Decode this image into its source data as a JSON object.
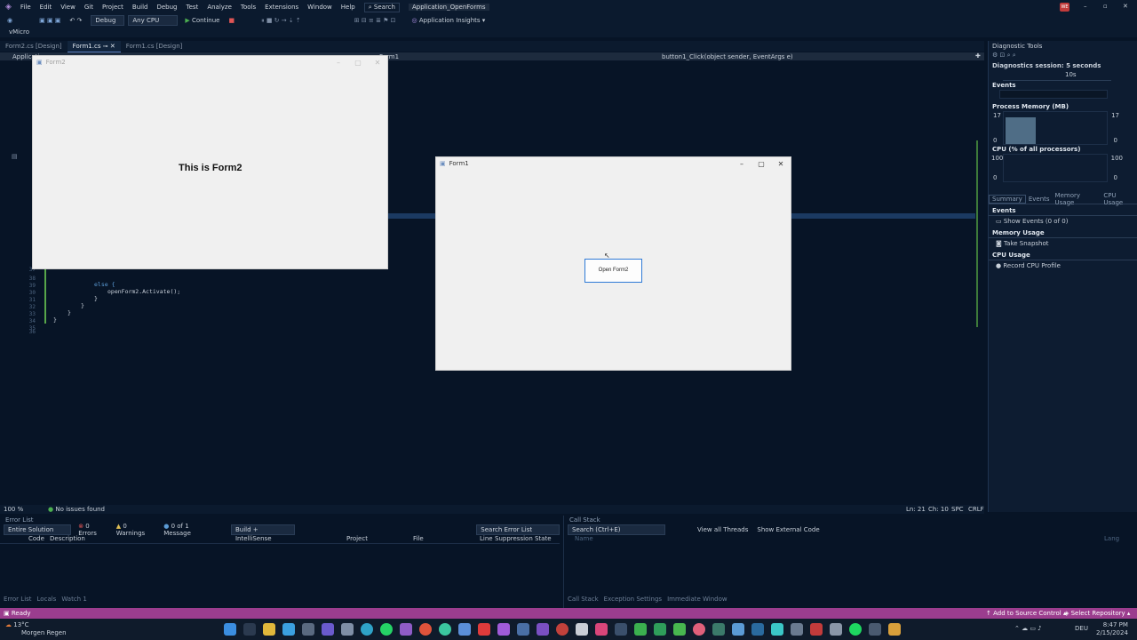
{
  "menu": [
    "File",
    "Edit",
    "View",
    "Git",
    "Project",
    "Build",
    "Debug",
    "Test",
    "Analyze",
    "Tools",
    "Extensions",
    "Window",
    "Help"
  ],
  "search_label": "Search",
  "solution_name": "Application_OpenForms",
  "user_badge": "WE",
  "toolbar": {
    "config": "Debug",
    "platform": "Any CPU",
    "continue": "Continue",
    "insights": "Application Insights"
  },
  "toolbar2_label": "vMicro",
  "tabs": [
    "Form2.cs [Design]",
    "Form1.cs",
    "Form1.cs [Design]"
  ],
  "navbar": {
    "left": "Applicati",
    "middle": "...ns.Form1",
    "right": "button1_Click(object sender, EventArgs e)"
  },
  "code": {
    "lines": [
      "37",
      "38",
      "39",
      "30",
      "31",
      "32",
      "33",
      "34",
      "35",
      "36"
    ],
    "else_kw": "else {",
    "activate": "openForm2.Activate();",
    "brace": "}"
  },
  "form2": {
    "title": "Form2",
    "label": "This is Form2"
  },
  "form1": {
    "title": "Form1",
    "button": "Open Form2"
  },
  "editor_status": {
    "zoom": "100 %",
    "issues": "No issues found",
    "ln": "Ln: 21",
    "ch": "Ch: 10",
    "spc": "SPC",
    "crlf": "CRLF"
  },
  "diagnostics": {
    "title": "Diagnostic Tools",
    "session": "Diagnostics session: 5 seconds",
    "tick": "10s",
    "events": "Events",
    "memory_title": "Process Memory (MB)",
    "memory_max": "17",
    "memory_min": "0",
    "cpu_title": "CPU (% of all processors)",
    "cpu_max": "100",
    "cpu_min": "0",
    "subtabs": [
      "Summary",
      "Events",
      "Memory Usage",
      "CPU Usage"
    ],
    "events_section": "Events",
    "show_events": "Show Events (0 of 0)",
    "memory_section": "Memory Usage",
    "snapshot": "Take Snapshot",
    "cpu_section": "CPU Usage",
    "record": "Record CPU Profile"
  },
  "error_list": {
    "title": "Error List",
    "scope": "Entire Solution",
    "errors": "0 Errors",
    "warnings": "0 Warnings",
    "messages": "0 of 1 Message",
    "build": "Build + IntelliSense",
    "search": "Search Error List",
    "columns": [
      "Code",
      "Description",
      "Project",
      "File",
      "Line",
      "Suppression State"
    ],
    "bottom_tabs": [
      "Error List",
      "Locals",
      "Watch 1"
    ]
  },
  "call_stack": {
    "title": "Call Stack",
    "search": "Search (Ctrl+E)",
    "all_threads": "View all Threads",
    "external": "Show External Code",
    "col_name": "Name",
    "col_lang": "Lang",
    "bottom_tabs": [
      "Call Stack",
      "Exception Settings",
      "Immediate Window"
    ]
  },
  "statusbar": {
    "ready": "Ready",
    "source": "Add to Source Control",
    "repo": "Select Repository"
  },
  "taskbar": {
    "temp": "13°C",
    "weather": "Morgen Regen",
    "lang": "DEU",
    "time": "8:47 PM",
    "date": "2/15/2024"
  },
  "colors": {
    "accent": "#9b3d8e",
    "bg": "#071426",
    "form_bg": "#f0f0f0"
  }
}
